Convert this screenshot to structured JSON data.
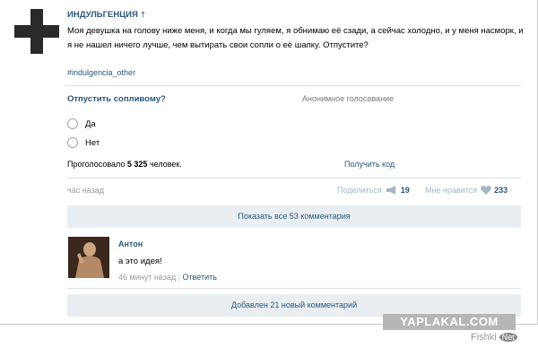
{
  "post": {
    "author": "ИНДУЛЬГЕНЦИЯ",
    "author_mark": "†",
    "text": "Моя девушка на голову ниже меня, и когда мы гуляем, я обнимаю её сзади, а сейчас холодно, и у меня насморк, и я не нашел ничего лучше, чем вытирать свои сопли о её шапку. Отпустите?",
    "hashtag": "#indulgencia_other"
  },
  "poll": {
    "question": "Отпустить сопливому?",
    "type": "Анонимное голосование",
    "options": [
      "Да",
      "Нет"
    ],
    "voted_prefix": "Проголосовало",
    "voted_count": "5 325",
    "voted_suffix": "человек.",
    "results_link": "Получить код"
  },
  "footer": {
    "time": "час назад",
    "share_label": "Поделиться",
    "share_count": "19",
    "like_label": "Мне нравится",
    "like_count": "233"
  },
  "comments": {
    "show_all": "Показать все 53 комментария",
    "new_comments": "Добавлен 21 новый комментарий",
    "items": [
      {
        "name": "Антон",
        "text": "а это идея!",
        "time": "46 минут назад",
        "reply": "Ответить"
      }
    ]
  },
  "watermark": {
    "site": "YAPLAKAL.COM",
    "brand": "Fishki",
    "brand_net": "Net"
  },
  "colors": {
    "link": "#2b587a",
    "bar_bg": "#e9eef3",
    "muted": "#999999"
  }
}
